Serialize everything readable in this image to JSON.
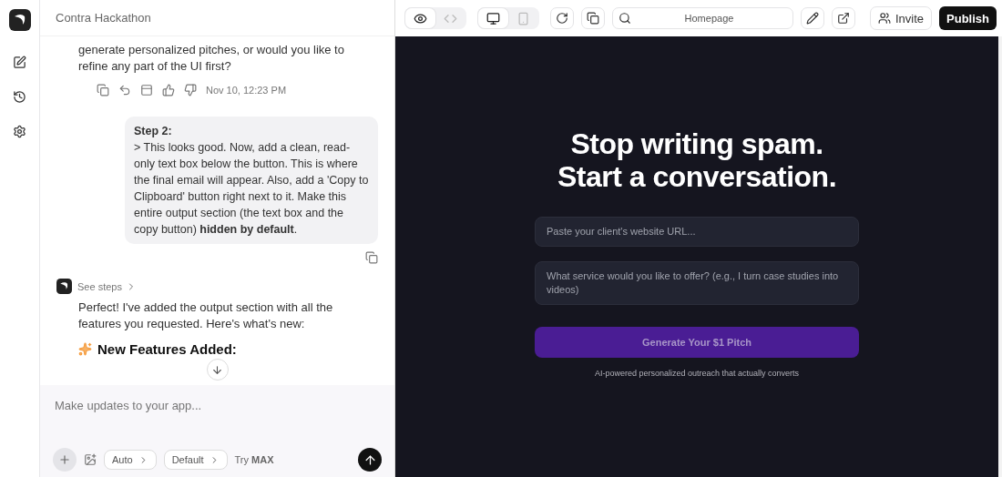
{
  "project": {
    "title": "Contra Hackathon"
  },
  "chat": {
    "messages": [
      {
        "kind": "assistant_tail",
        "text": "generate personalized pitches, or would you like to refine any part of the UI first?",
        "timestamp": "Nov 10, 12:23 PM"
      },
      {
        "kind": "user",
        "title": "Step 2:",
        "body": "> This looks good. Now, add a clean, read-only text box below the button. This is where the final email will appear. Also, add a 'Copy to Clipboard' button right next to it. Make this entire output section (the text box and the copy button) **hidden by default**."
      },
      {
        "kind": "assistant",
        "steps_label": "See steps",
        "text": "Perfect! I've added the output section with all the features you requested. Here's what's new:",
        "heading": "New Features Added:"
      }
    ]
  },
  "composer": {
    "placeholder": "Make updates to your app...",
    "mode": "Auto",
    "model": "Default",
    "upgrade": "Try **MAX**"
  },
  "toolbar": {
    "view_toggle": [
      {
        "kind": "preview",
        "selected": true
      },
      {
        "kind": "code",
        "selected": false
      }
    ],
    "device_toggle": [
      {
        "kind": "desktop",
        "selected": true
      },
      {
        "kind": "mobile",
        "selected": false
      }
    ],
    "page": "Homepage",
    "invite": "Invite",
    "publish": "Publish"
  },
  "preview": {
    "headline": [
      "Stop writing spam.",
      "Start a conversation."
    ],
    "fields": [
      {
        "placeholder": "Paste your client's website URL..."
      },
      {
        "placeholder": "What service would you like to offer? (e.g., I turn case studies into videos)"
      }
    ],
    "button": "Generate Your $1 Pitch",
    "tagline": "AI-powered personalized outreach that actually converts"
  }
}
